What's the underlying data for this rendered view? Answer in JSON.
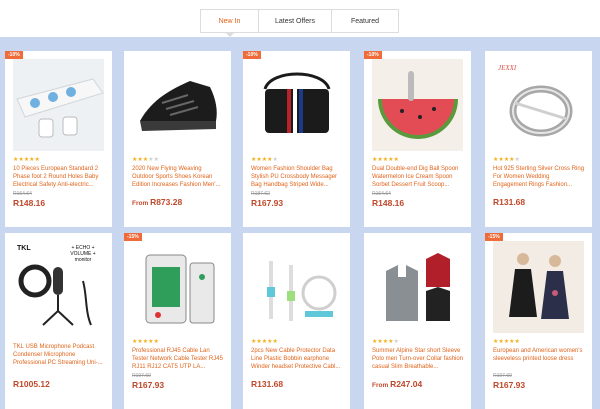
{
  "tabs": [
    {
      "label": "New In",
      "active": true
    },
    {
      "label": "Latest Offers",
      "active": false
    },
    {
      "label": "Featured",
      "active": false
    }
  ],
  "colors": {
    "accent": "#e0641b",
    "price": "#c0482a",
    "background": "#c9d6ef",
    "badge": "#ef6b3a",
    "stars": "#f2b01e"
  },
  "products": [
    {
      "badge": "-10%",
      "rating": 5,
      "title": "10 Pieces European Standard 2 Phase foot 2 Round Holes Baby Electrical Safety Anti-electric...",
      "old_price": "R164.64",
      "price": "R148.16",
      "icon": "power-socket-strip-image"
    },
    {
      "badge": "",
      "rating": 3,
      "title": "2020 New Flying Weaving Outdoor Sports Shoes Korean Edition Increases Fashion Men'...",
      "old_price": "",
      "from": "From ",
      "price": "R873.28",
      "icon": "black-shoe-image"
    },
    {
      "badge": "-10%",
      "rating": 4,
      "title": "Women Fashion Shoulder Bag Stylish PU Crossbody Messager Bag Handbag Striped Wide...",
      "old_price": "R187.62",
      "price": "R167.93",
      "icon": "shoulder-bag-image"
    },
    {
      "badge": "-10%",
      "rating": 5,
      "title": "Dual Double-end Dig Ball Spoon Watermelon Ice Cream Spoon Sorbet Dessert Fruit Scoop...",
      "old_price": "R164.64",
      "price": "R148.16",
      "icon": "watermelon-spoon-image"
    },
    {
      "badge": "",
      "rating": 4,
      "title": "Hot 925 Sterling Silver Cross Ring For Women Wedding Engagement Rings Fashion...",
      "old_price": "",
      "price": "R131.68",
      "icon": "silver-ring-image",
      "brand": "JEXXI"
    },
    {
      "badge": "",
      "rating": 0,
      "title": "TKL USB Microphone Podcast Condenser Microphone Professional PC Streaming Uni-...",
      "old_price": "",
      "price": "R1005.12",
      "icon": "microphone-kit-image",
      "brand": "TKL",
      "note": "+ ECHO + VOLUME + monitor"
    },
    {
      "badge": "-15%",
      "rating": 5,
      "title": "Professional RJ45 Cable Lan Tester Network Cable Tester RJ45 RJ11 RJ12 CAT5 UTP LA...",
      "old_price": "R197.60",
      "price": "R167.93",
      "icon": "cable-tester-image"
    },
    {
      "badge": "",
      "rating": 5,
      "title": "2pcs New Cable Protector Data Line Plastic Bobbin earphone Winder headset Protective Cabl...",
      "old_price": "",
      "price": "R131.68",
      "icon": "cable-protector-image"
    },
    {
      "badge": "",
      "rating": 4,
      "title": "Summer Alpine Star short Sleeve Polo men Turn-over Collar fashion casual Slim Breathable...",
      "old_price": "",
      "from": "From ",
      "price": "R247.04",
      "icon": "polo-shirts-image"
    },
    {
      "badge": "-15%",
      "rating": 5,
      "title": "European and American women's sleeveless printed loose dress",
      "old_price": "R197.60",
      "price": "R167.93",
      "icon": "dress-image"
    }
  ]
}
